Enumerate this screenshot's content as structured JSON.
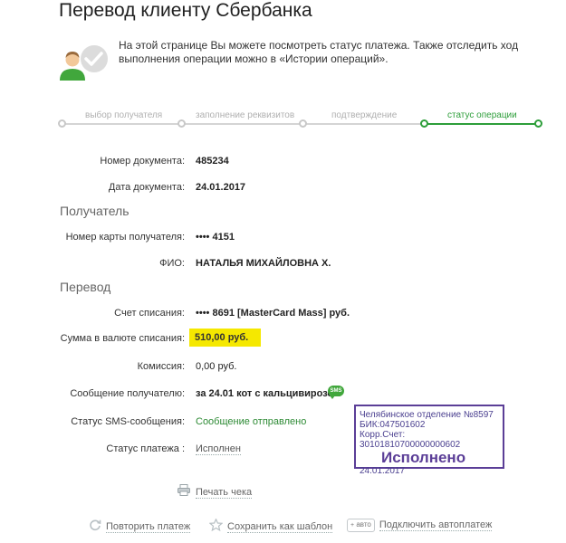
{
  "page": {
    "title": "Перевод клиенту Сбербанка",
    "info_text": "На этой странице Вы можете посмотреть статус платежа. Также отследить ход выполнения операции можно в «Истории операций»."
  },
  "steps": [
    {
      "label": "выбор получателя",
      "active": false
    },
    {
      "label": "заполнение реквизитов",
      "active": false
    },
    {
      "label": "подтверждение",
      "active": false
    },
    {
      "label": "статус операции",
      "active": true
    }
  ],
  "document": {
    "number_label": "Номер документа:",
    "number_value": "485234",
    "date_label": "Дата документа:",
    "date_value": "24.01.2017"
  },
  "recipient": {
    "section_title": "Получатель",
    "card_label": "Номер карты получателя:",
    "card_value": "•••• 4151",
    "name_label": "ФИО:",
    "name_value": "НАТАЛЬЯ МИХАЙЛОВНА Х."
  },
  "transfer": {
    "section_title": "Перевод",
    "account_label": "Счет списания:",
    "account_value": "•••• 8691  [MasterCard Mass]  руб.",
    "amount_label": "Сумма в валюте списания:",
    "amount_value": "510,00  руб.",
    "commission_label": "Комиссия:",
    "commission_value": "0,00 руб.",
    "message_label": "Сообщение получателю:",
    "message_value": "за 24.01 кот с кальцивирозом",
    "sms_badge": "SMS",
    "sms_status_label": "Статус SMS-сообщения:",
    "sms_status_value": "Сообщение отправлено",
    "payment_status_label": "Статус платежа :",
    "payment_status_value": "Исполнен"
  },
  "stamp": {
    "line1": "Челябинское отделение №8597",
    "line2": "БИК:047501602",
    "line3": "Корр.Счет: 30101810700000000602",
    "status": "Исполнено",
    "date": "24.01.2017"
  },
  "actions": {
    "print_receipt": "Печать чека",
    "repeat_payment": "Повторить платеж",
    "save_template": "Сохранить как шаблон",
    "auto_badge": "авто",
    "connect_autopayment": "Подключить автоплатеж"
  },
  "colors": {
    "accent_green": "#2d9e3a",
    "highlight_yellow": "#f5e800",
    "stamp_purple": "#5b3e97"
  }
}
